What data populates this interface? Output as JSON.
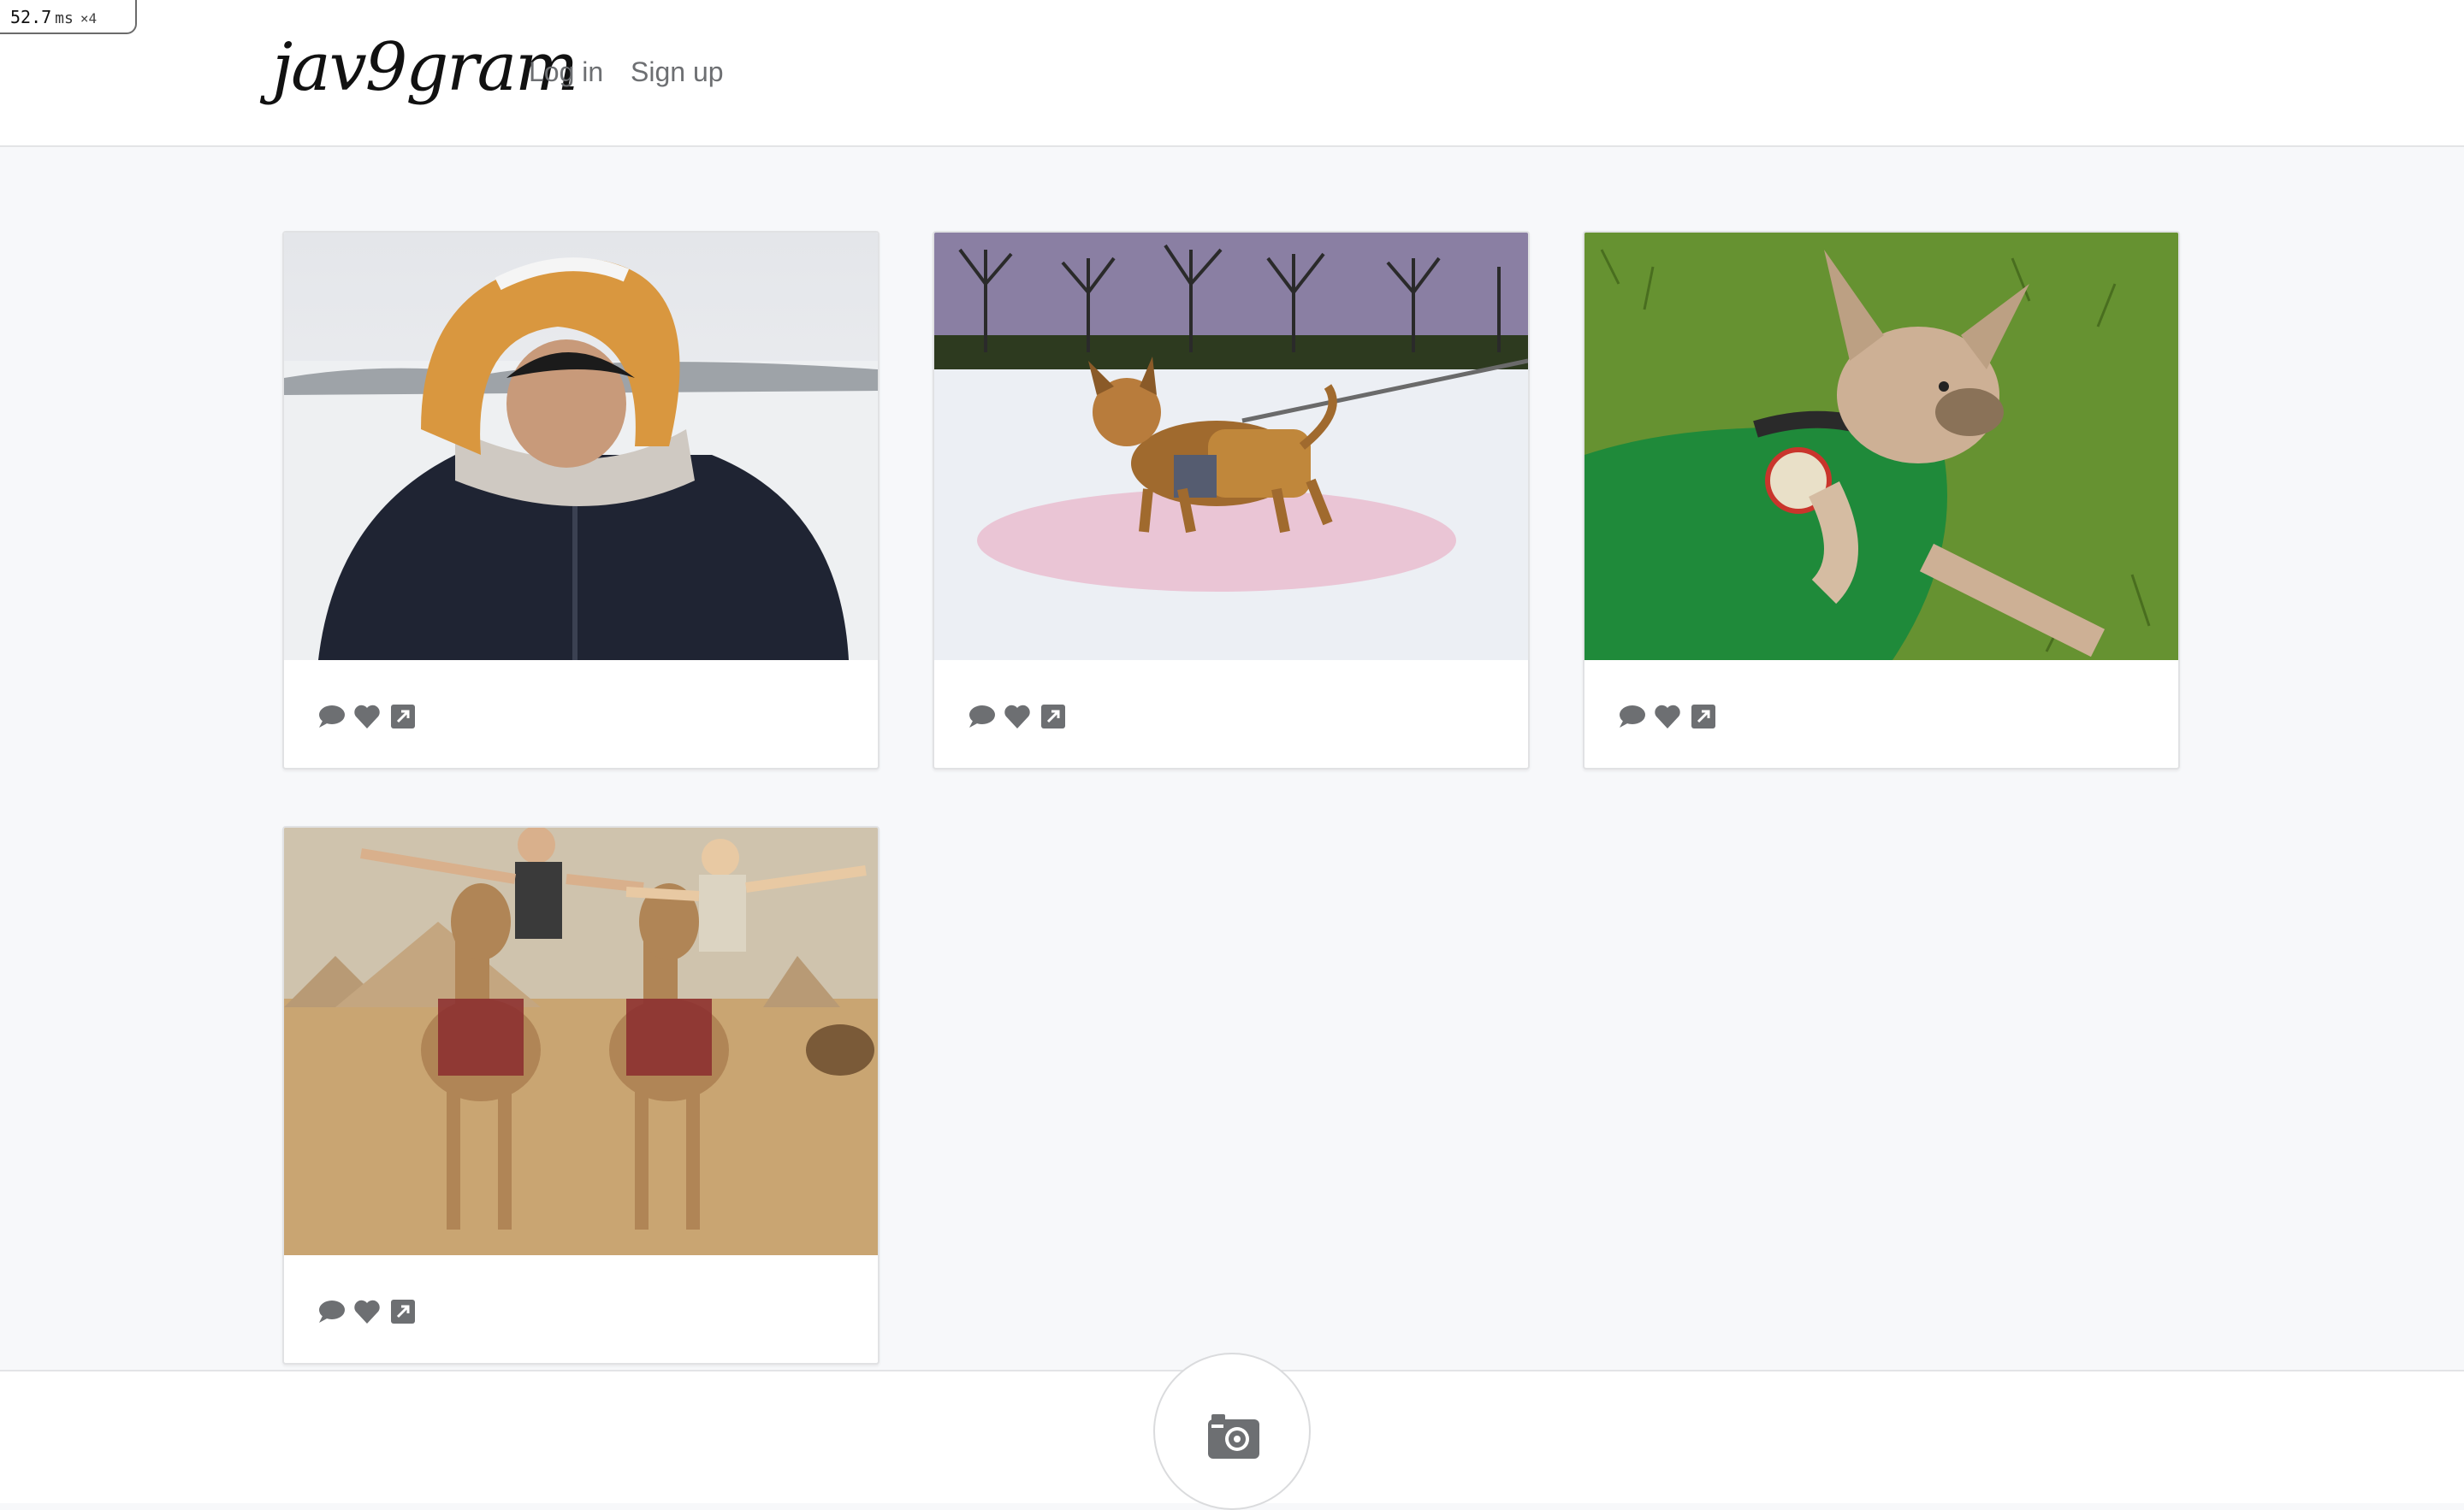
{
  "perf": {
    "value": "52.7",
    "unit": "ms",
    "multiplier": "×4"
  },
  "brand": {
    "logo_text": "jav9gram"
  },
  "nav": {
    "login_label": "Log in",
    "signup_label": "Sign up"
  },
  "posts": [
    {
      "image": "man in orange hood in snow",
      "actions": [
        "comment-icon",
        "heart-icon",
        "share-icon"
      ]
    },
    {
      "image": "small dog in coat on snowy field",
      "actions": [
        "comment-icon",
        "heart-icon",
        "share-icon"
      ]
    },
    {
      "image": "chihuahua in green jersey lying on grass",
      "actions": [
        "comment-icon",
        "heart-icon",
        "share-icon"
      ]
    },
    {
      "image": "two people riding camels near pyramids",
      "actions": [
        "comment-icon",
        "heart-icon",
        "share-icon"
      ]
    }
  ],
  "footer": {
    "camera_button": "camera-icon"
  },
  "colors": {
    "background": "#f7f8fa",
    "icon": "#6d6f72",
    "nav_text": "#6d6f72"
  }
}
